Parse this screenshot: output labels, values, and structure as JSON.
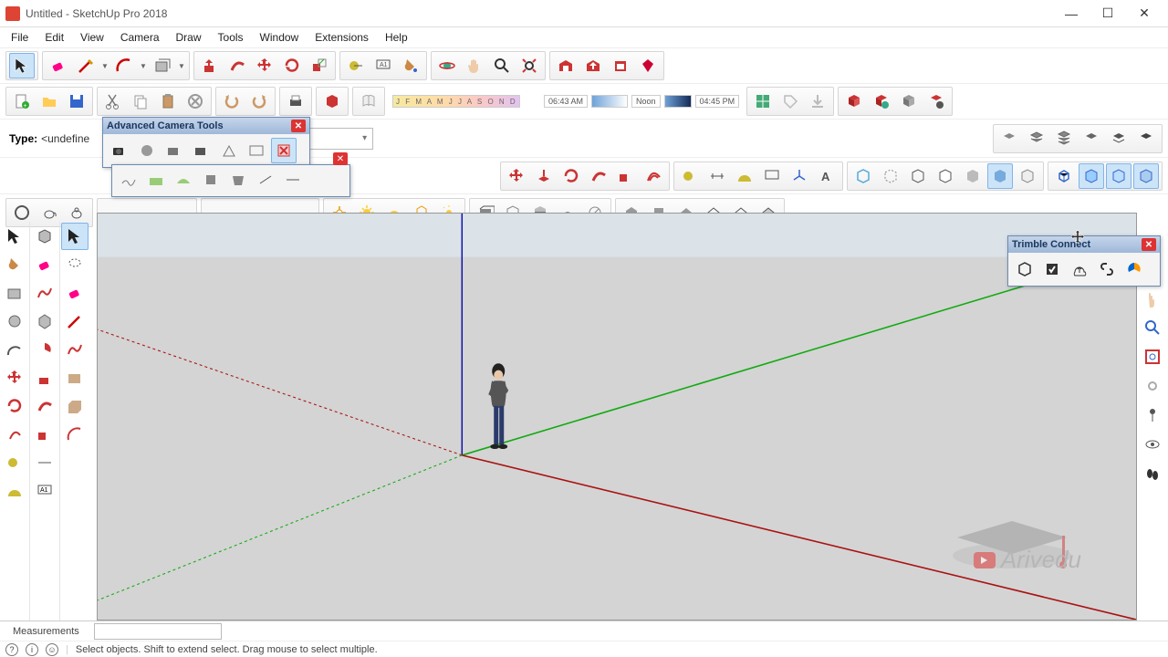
{
  "app": {
    "title": "Untitled - SketchUp Pro 2018"
  },
  "menu": [
    "File",
    "Edit",
    "View",
    "Camera",
    "Draw",
    "Tools",
    "Window",
    "Extensions",
    "Help"
  ],
  "type_row": {
    "label": "Type:",
    "value": "<undefine"
  },
  "months": "J F M A M J J A S O N D",
  "time_am": "06:43 AM",
  "time_noon": "Noon",
  "time_pm": "04:45 PM",
  "float_act": {
    "title": "Advanced Camera Tools"
  },
  "float_tc": {
    "title": "Trimble Connect"
  },
  "status": {
    "measurements": "Measurements"
  },
  "hint": "Select objects. Shift to extend select. Drag mouse to select multiple.",
  "watermark": "Arivedu"
}
